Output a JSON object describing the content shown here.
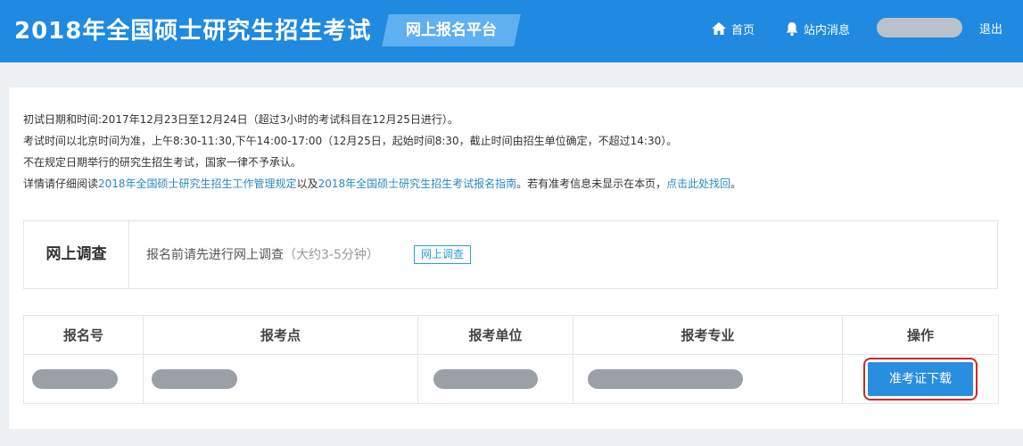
{
  "header": {
    "site_title": "2018年全国硕士研究生招生考试",
    "platform_label": "网上报名平台",
    "nav_home": "首页",
    "nav_messages": "站内消息",
    "logout": "退出"
  },
  "notice": {
    "line1": "初试日期和时间:2017年12月23日至12月24日（超过3小时的考试科目在12月25日进行）。",
    "line2": "考试时间以北京时间为准，上午8:30-11:30,下午14:00-17:00（12月25日，起始时间8:30，截止时间由招生单位确定，不超过14:30）。",
    "line3": "不在规定日期举行的研究生招生考试，国家一律不予承认。",
    "line4_prefix": "详情请仔细阅读",
    "link_regulation": "2018年全国硕士研究生招生工作管理规定",
    "line4_mid": "以及",
    "link_guide": "2018年全国硕士研究生招生考试报名指南",
    "line4_suffix": "。若有准考信息未显示在本页，",
    "link_retrieve": "点击此处找回",
    "line4_end": "。"
  },
  "survey": {
    "title": "网上调查",
    "description": "报名前请先进行网上调查",
    "duration_note": "（大约3-5分钟）",
    "button": "网上调查"
  },
  "table": {
    "headers": [
      "报名号",
      "报考点",
      "报考单位",
      "报考专业",
      "操作"
    ],
    "action_button": "准考证下载"
  },
  "colors": {
    "header_blue": "#1f8ae0",
    "link_blue": "#2a88c8",
    "highlight_red": "#d2272b"
  }
}
